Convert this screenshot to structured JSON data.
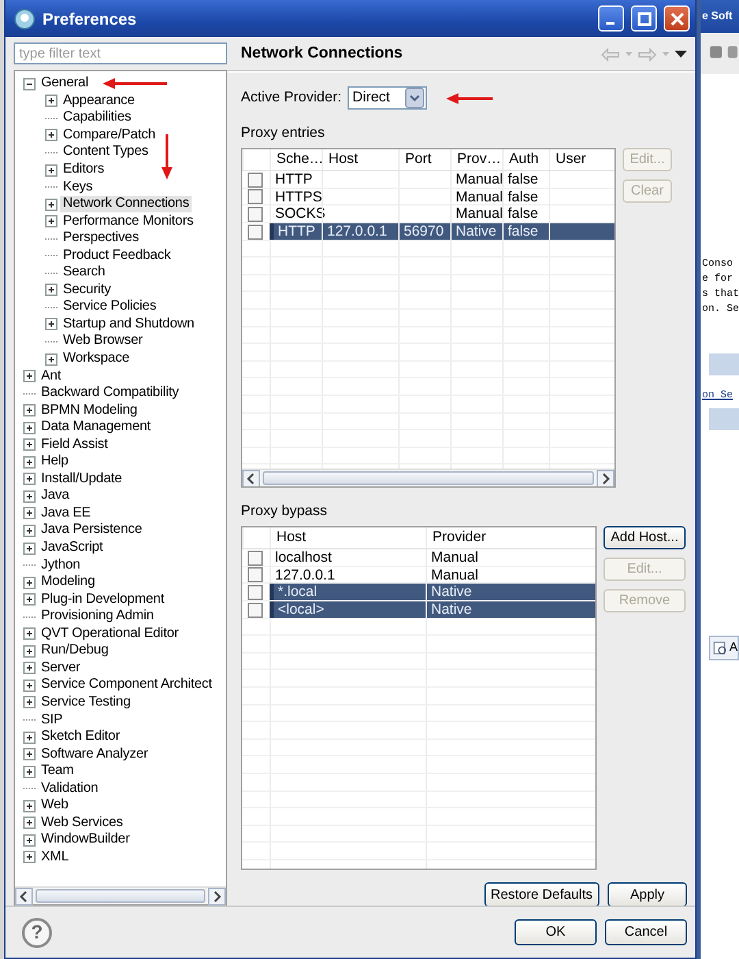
{
  "window": {
    "title": "Preferences"
  },
  "filter": {
    "placeholder": "type filter text"
  },
  "tree": [
    {
      "label": "General",
      "expandable": true,
      "expanded": true,
      "selected": false,
      "children": [
        {
          "label": "Appearance",
          "expandable": true,
          "expanded": false,
          "selected": false
        },
        {
          "label": "Capabilities",
          "expandable": false,
          "selected": false
        },
        {
          "label": "Compare/Patch",
          "expandable": true,
          "expanded": false,
          "selected": false
        },
        {
          "label": "Content Types",
          "expandable": false,
          "selected": false
        },
        {
          "label": "Editors",
          "expandable": true,
          "expanded": false,
          "selected": false
        },
        {
          "label": "Keys",
          "expandable": false,
          "selected": false
        },
        {
          "label": "Network Connections",
          "expandable": true,
          "expanded": false,
          "selected": true
        },
        {
          "label": "Performance Monitors",
          "expandable": true,
          "expanded": false,
          "selected": false
        },
        {
          "label": "Perspectives",
          "expandable": false,
          "selected": false
        },
        {
          "label": "Product Feedback",
          "expandable": false,
          "selected": false
        },
        {
          "label": "Search",
          "expandable": false,
          "selected": false
        },
        {
          "label": "Security",
          "expandable": true,
          "expanded": false,
          "selected": false
        },
        {
          "label": "Service Policies",
          "expandable": false,
          "selected": false
        },
        {
          "label": "Startup and Shutdown",
          "expandable": true,
          "expanded": false,
          "selected": false
        },
        {
          "label": "Web Browser",
          "expandable": false,
          "selected": false
        },
        {
          "label": "Workspace",
          "expandable": true,
          "expanded": false,
          "selected": false
        }
      ]
    },
    {
      "label": "Ant",
      "expandable": true,
      "expanded": false,
      "selected": false
    },
    {
      "label": "Backward Compatibility",
      "expandable": false,
      "selected": false
    },
    {
      "label": "BPMN Modeling",
      "expandable": true,
      "expanded": false,
      "selected": false
    },
    {
      "label": "Data Management",
      "expandable": true,
      "expanded": false,
      "selected": false
    },
    {
      "label": "Field Assist",
      "expandable": true,
      "expanded": false,
      "selected": false
    },
    {
      "label": "Help",
      "expandable": true,
      "expanded": false,
      "selected": false
    },
    {
      "label": "Install/Update",
      "expandable": true,
      "expanded": false,
      "selected": false
    },
    {
      "label": "Java",
      "expandable": true,
      "expanded": false,
      "selected": false
    },
    {
      "label": "Java EE",
      "expandable": true,
      "expanded": false,
      "selected": false
    },
    {
      "label": "Java Persistence",
      "expandable": true,
      "expanded": false,
      "selected": false
    },
    {
      "label": "JavaScript",
      "expandable": true,
      "expanded": false,
      "selected": false
    },
    {
      "label": "Jython",
      "expandable": false,
      "selected": false
    },
    {
      "label": "Modeling",
      "expandable": true,
      "expanded": false,
      "selected": false
    },
    {
      "label": "Plug-in Development",
      "expandable": true,
      "expanded": false,
      "selected": false
    },
    {
      "label": "Provisioning Admin",
      "expandable": false,
      "selected": false
    },
    {
      "label": "QVT Operational Editor",
      "expandable": true,
      "expanded": false,
      "selected": false
    },
    {
      "label": "Run/Debug",
      "expandable": true,
      "expanded": false,
      "selected": false
    },
    {
      "label": "Server",
      "expandable": true,
      "expanded": false,
      "selected": false
    },
    {
      "label": "Service Component Architect",
      "expandable": true,
      "expanded": false,
      "selected": false
    },
    {
      "label": "Service Testing",
      "expandable": true,
      "expanded": false,
      "selected": false
    },
    {
      "label": "SIP",
      "expandable": false,
      "selected": false
    },
    {
      "label": "Sketch Editor",
      "expandable": true,
      "expanded": false,
      "selected": false
    },
    {
      "label": "Software Analyzer",
      "expandable": true,
      "expanded": false,
      "selected": false
    },
    {
      "label": "Team",
      "expandable": true,
      "expanded": false,
      "selected": false
    },
    {
      "label": "Validation",
      "expandable": false,
      "selected": false
    },
    {
      "label": "Web",
      "expandable": true,
      "expanded": false,
      "selected": false
    },
    {
      "label": "Web Services",
      "expandable": true,
      "expanded": false,
      "selected": false
    },
    {
      "label": "WindowBuilder",
      "expandable": true,
      "expanded": false,
      "selected": false
    },
    {
      "label": "XML",
      "expandable": true,
      "expanded": false,
      "selected": false
    }
  ],
  "page": {
    "title": "Network Connections",
    "active_provider": {
      "label": "Active Provider:",
      "value": "Direct"
    },
    "proxy_entries": {
      "title": "Proxy entries",
      "columns": [
        "Sche…",
        "Host",
        "Port",
        "Prov…",
        "Auth",
        "User"
      ],
      "rows": [
        {
          "scheme": "HTTP",
          "provider": "Manual",
          "auth": "false",
          "checked": false,
          "selected": false
        },
        {
          "scheme": "HTTPS",
          "provider": "Manual",
          "auth": "false",
          "checked": false,
          "selected": false
        },
        {
          "scheme": "SOCKS",
          "provider": "Manual",
          "auth": "false",
          "checked": false,
          "selected": false
        },
        {
          "scheme": "HTTP",
          "host": "127.0.0.1",
          "port": "56970",
          "provider": "Native",
          "auth": "false",
          "checked": false,
          "selected": true
        }
      ],
      "buttons": [
        {
          "label": "Edit...",
          "disabled": true
        },
        {
          "label": "Clear",
          "disabled": true
        }
      ]
    },
    "proxy_bypass": {
      "title": "Proxy bypass",
      "columns": [
        "Host",
        "Provider"
      ],
      "rows": [
        {
          "host": "localhost",
          "provider": "Manual",
          "checked": false,
          "selected": false
        },
        {
          "host": "127.0.0.1",
          "provider": "Manual",
          "checked": false,
          "selected": false
        },
        {
          "host": "*.local",
          "provider": "Native",
          "checked": false,
          "selected": true
        },
        {
          "host": "<local>",
          "provider": "Native",
          "checked": false,
          "selected": true
        }
      ],
      "buttons": [
        {
          "label": "Add Host...",
          "disabled": false
        },
        {
          "label": "Edit...",
          "disabled": true
        },
        {
          "label": "Remove",
          "disabled": true
        }
      ]
    },
    "buttons": [
      {
        "label": "Restore Defaults"
      },
      {
        "label": "Apply"
      }
    ]
  },
  "help": {
    "glyph": "?"
  },
  "dialog_buttons": [
    {
      "label": "OK"
    },
    {
      "label": "Cancel"
    }
  ],
  "background_window": {
    "title": "e Soft",
    "text_lines": [
      "Conso",
      "e for",
      "s that",
      "on. Se"
    ],
    "link": "on Se",
    "tab_label": "A"
  }
}
